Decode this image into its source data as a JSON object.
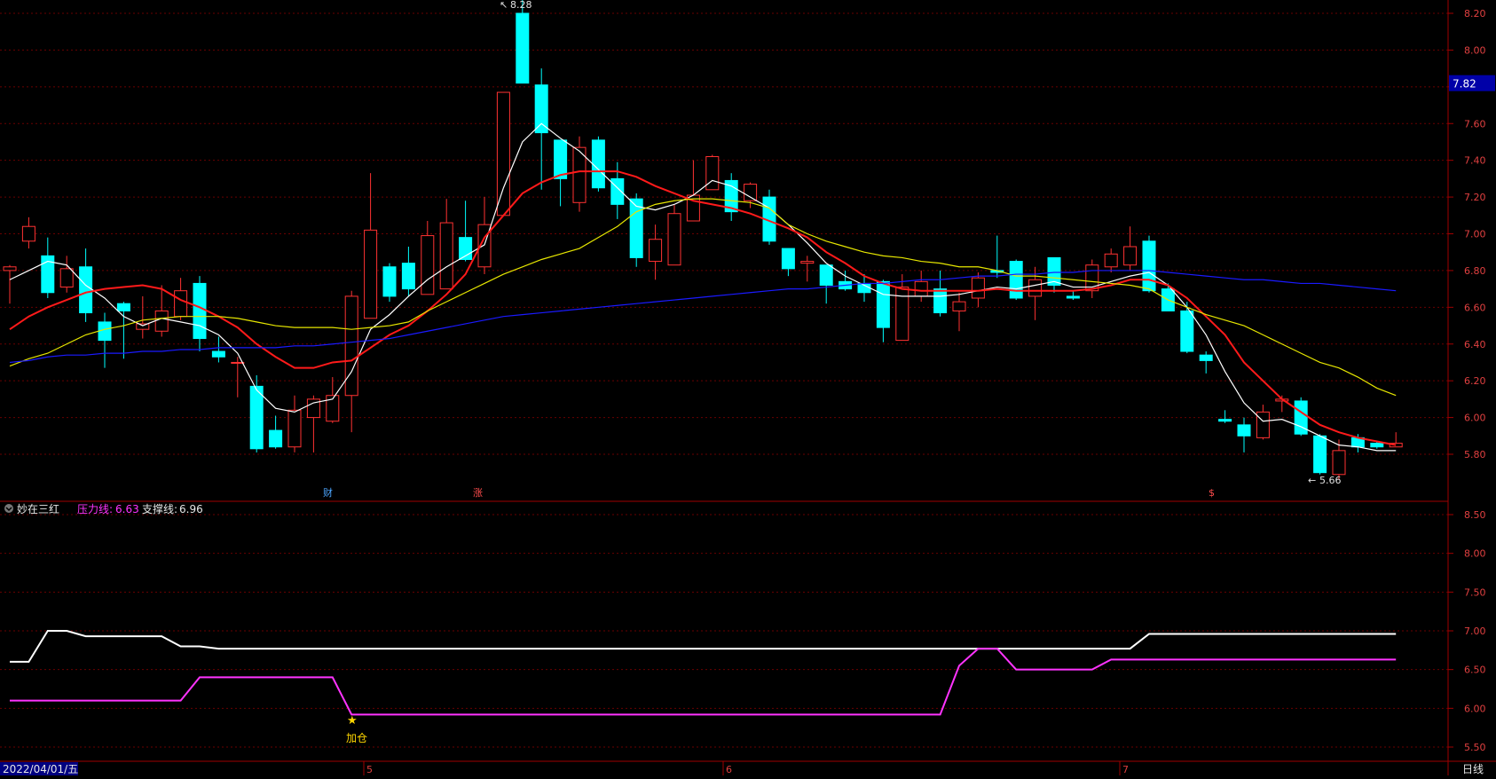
{
  "chart_data": {
    "type": "candlestick",
    "period_label": "日线",
    "date_label": "2022/04/01/五",
    "month_ticks": [
      "5",
      "6",
      "7"
    ],
    "main_panel": {
      "price_ticks": [
        "5.80",
        "6.00",
        "6.20",
        "6.40",
        "6.60",
        "6.80",
        "7.00",
        "7.20",
        "7.40",
        "7.60",
        "7.80",
        "8.00",
        "8.20"
      ],
      "ylim": [
        5.66,
        8.32
      ],
      "current_price": "7.82",
      "high_marker": "8.28",
      "low_marker": "5.66",
      "event_markers": [
        "财",
        "涨",
        "$"
      ],
      "candles": [
        [
          6.8,
          6.82,
          6.83,
          6.62
        ],
        [
          6.96,
          7.04,
          7.09,
          6.92
        ],
        [
          6.88,
          6.68,
          6.98,
          6.65
        ],
        [
          6.71,
          6.81,
          6.88,
          6.68
        ],
        [
          6.82,
          6.57,
          6.92,
          6.52
        ],
        [
          6.52,
          6.42,
          6.57,
          6.27
        ],
        [
          6.62,
          6.58,
          6.63,
          6.32
        ],
        [
          6.48,
          6.51,
          6.66,
          6.43
        ],
        [
          6.47,
          6.58,
          6.72,
          6.44
        ],
        [
          6.55,
          6.69,
          6.76,
          6.53
        ],
        [
          6.73,
          6.43,
          6.77,
          6.36
        ],
        [
          6.36,
          6.33,
          6.44,
          6.3
        ],
        [
          6.3,
          6.3,
          6.33,
          6.11
        ],
        [
          6.17,
          5.83,
          6.23,
          5.81
        ],
        [
          5.93,
          5.84,
          6.01,
          5.83
        ],
        [
          5.84,
          6.04,
          6.12,
          5.81
        ],
        [
          6.0,
          6.1,
          6.12,
          5.81
        ],
        [
          5.98,
          6.12,
          6.22,
          5.97
        ],
        [
          6.12,
          6.66,
          6.69,
          5.92
        ],
        [
          6.54,
          7.02,
          7.33,
          6.54
        ],
        [
          6.82,
          6.66,
          6.84,
          6.63
        ],
        [
          6.84,
          6.7,
          6.93,
          6.66
        ],
        [
          6.67,
          6.99,
          7.07,
          6.67
        ],
        [
          6.7,
          7.06,
          7.19,
          6.7
        ],
        [
          6.98,
          6.86,
          7.18,
          6.85
        ],
        [
          6.82,
          7.05,
          7.2,
          6.78
        ],
        [
          7.1,
          7.77,
          7.77,
          7.1
        ],
        [
          8.2,
          7.82,
          8.28,
          7.82
        ],
        [
          7.81,
          7.55,
          7.9,
          7.24
        ],
        [
          7.51,
          7.3,
          7.51,
          7.15
        ],
        [
          7.17,
          7.47,
          7.53,
          7.12
        ],
        [
          7.51,
          7.25,
          7.53,
          7.23
        ],
        [
          7.3,
          7.16,
          7.39,
          7.08
        ],
        [
          7.19,
          6.87,
          7.22,
          6.82
        ],
        [
          6.85,
          6.97,
          7.05,
          6.75
        ],
        [
          6.83,
          7.11,
          7.16,
          6.83
        ],
        [
          7.07,
          7.21,
          7.4,
          7.07
        ],
        [
          7.24,
          7.42,
          7.43,
          7.24
        ],
        [
          7.29,
          7.12,
          7.33,
          7.07
        ],
        [
          7.18,
          7.27,
          7.28,
          7.14
        ],
        [
          7.2,
          6.96,
          7.24,
          6.94
        ],
        [
          6.92,
          6.81,
          6.92,
          6.77
        ],
        [
          6.84,
          6.85,
          6.88,
          6.74
        ],
        [
          6.83,
          6.72,
          6.83,
          6.62
        ],
        [
          6.74,
          6.7,
          6.8,
          6.69
        ],
        [
          6.73,
          6.68,
          6.78,
          6.63
        ],
        [
          6.74,
          6.49,
          6.75,
          6.41
        ],
        [
          6.42,
          6.71,
          6.78,
          6.42
        ],
        [
          6.66,
          6.74,
          6.8,
          6.63
        ],
        [
          6.7,
          6.57,
          6.8,
          6.55
        ],
        [
          6.58,
          6.63,
          6.68,
          6.47
        ],
        [
          6.65,
          6.76,
          6.79,
          6.6
        ],
        [
          6.8,
          6.79,
          6.99,
          6.76
        ],
        [
          6.85,
          6.65,
          6.86,
          6.64
        ],
        [
          6.66,
          6.75,
          6.82,
          6.53
        ],
        [
          6.87,
          6.72,
          6.87,
          6.68
        ],
        [
          6.66,
          6.65,
          6.69,
          6.64
        ],
        [
          6.69,
          6.83,
          6.86,
          6.65
        ],
        [
          6.82,
          6.89,
          6.92,
          6.79
        ],
        [
          6.83,
          6.93,
          7.04,
          6.8
        ],
        [
          6.96,
          6.69,
          6.99,
          6.68
        ],
        [
          6.7,
          6.58,
          6.73,
          6.58
        ],
        [
          6.58,
          6.36,
          6.63,
          6.35
        ],
        [
          6.34,
          6.31,
          6.36,
          6.24
        ],
        [
          5.99,
          5.98,
          6.04,
          5.97
        ],
        [
          5.96,
          5.9,
          6.0,
          5.81
        ],
        [
          5.89,
          6.03,
          6.07,
          5.88
        ],
        [
          6.09,
          6.1,
          6.12,
          6.03
        ],
        [
          6.09,
          5.91,
          6.11,
          5.9
        ],
        [
          5.9,
          5.7,
          5.91,
          5.69
        ],
        [
          5.69,
          5.82,
          5.88,
          5.66
        ],
        [
          5.89,
          5.84,
          5.91,
          5.81
        ],
        [
          5.86,
          5.84,
          5.87,
          5.83
        ],
        [
          5.84,
          5.86,
          5.92,
          5.84
        ]
      ],
      "series": [
        {
          "name": "MA5",
          "color": "#ffffff",
          "values": [
            6.75,
            6.8,
            6.85,
            6.83,
            6.72,
            6.65,
            6.55,
            6.5,
            6.54,
            6.52,
            6.5,
            6.45,
            6.35,
            6.15,
            6.05,
            6.03,
            6.08,
            6.1,
            6.25,
            6.48,
            6.56,
            6.66,
            6.75,
            6.82,
            6.88,
            6.94,
            7.25,
            7.5,
            7.6,
            7.52,
            7.45,
            7.35,
            7.25,
            7.15,
            7.13,
            7.16,
            7.21,
            7.29,
            7.26,
            7.2,
            7.14,
            7.05,
            6.95,
            6.84,
            6.77,
            6.72,
            6.67,
            6.66,
            6.66,
            6.66,
            6.67,
            6.69,
            6.71,
            6.7,
            6.72,
            6.74,
            6.71,
            6.71,
            6.74,
            6.77,
            6.79,
            6.72,
            6.6,
            6.45,
            6.25,
            6.08,
            5.98,
            5.99,
            5.95,
            5.9,
            5.85,
            5.84,
            5.82,
            5.82
          ]
        },
        {
          "name": "MA10",
          "color": "#ff1a1a",
          "values": [
            6.48,
            6.55,
            6.6,
            6.64,
            6.68,
            6.7,
            6.71,
            6.72,
            6.7,
            6.64,
            6.6,
            6.55,
            6.49,
            6.4,
            6.33,
            6.27,
            6.27,
            6.3,
            6.31,
            6.38,
            6.45,
            6.5,
            6.58,
            6.67,
            6.78,
            6.98,
            7.1,
            7.22,
            7.28,
            7.32,
            7.34,
            7.34,
            7.34,
            7.31,
            7.26,
            7.22,
            7.18,
            7.16,
            7.14,
            7.11,
            7.07,
            7.03,
            6.98,
            6.9,
            6.84,
            6.77,
            6.73,
            6.7,
            6.69,
            6.69,
            6.69,
            6.69,
            6.7,
            6.69,
            6.69,
            6.69,
            6.69,
            6.7,
            6.72,
            6.75,
            6.75,
            6.72,
            6.65,
            6.55,
            6.45,
            6.3,
            6.2,
            6.1,
            6.03,
            5.96,
            5.92,
            5.89,
            5.87,
            5.85
          ]
        },
        {
          "name": "MA20",
          "color": "#e6e600",
          "values": [
            6.28,
            6.32,
            6.35,
            6.4,
            6.45,
            6.48,
            6.5,
            6.53,
            6.54,
            6.55,
            6.55,
            6.55,
            6.54,
            6.52,
            6.5,
            6.49,
            6.49,
            6.49,
            6.48,
            6.49,
            6.5,
            6.52,
            6.58,
            6.63,
            6.68,
            6.73,
            6.78,
            6.82,
            6.86,
            6.89,
            6.92,
            6.98,
            7.04,
            7.12,
            7.16,
            7.18,
            7.19,
            7.19,
            7.18,
            7.17,
            7.14,
            7.05,
            7.0,
            6.96,
            6.93,
            6.9,
            6.88,
            6.87,
            6.85,
            6.84,
            6.82,
            6.82,
            6.8,
            6.77,
            6.77,
            6.76,
            6.75,
            6.74,
            6.73,
            6.72,
            6.7,
            6.64,
            6.6,
            6.56,
            6.53,
            6.5,
            6.45,
            6.4,
            6.35,
            6.3,
            6.27,
            6.22,
            6.16,
            6.12
          ]
        },
        {
          "name": "MA60",
          "color": "#1a1aff",
          "values": [
            6.3,
            6.31,
            6.33,
            6.34,
            6.34,
            6.35,
            6.35,
            6.36,
            6.36,
            6.37,
            6.37,
            6.38,
            6.38,
            6.38,
            6.38,
            6.39,
            6.39,
            6.4,
            6.41,
            6.42,
            6.43,
            6.45,
            6.47,
            6.49,
            6.51,
            6.53,
            6.55,
            6.56,
            6.57,
            6.58,
            6.59,
            6.6,
            6.61,
            6.62,
            6.63,
            6.64,
            6.65,
            6.66,
            6.67,
            6.68,
            6.69,
            6.7,
            6.7,
            6.71,
            6.72,
            6.73,
            6.73,
            6.74,
            6.75,
            6.75,
            6.76,
            6.77,
            6.77,
            6.78,
            6.78,
            6.79,
            6.79,
            6.8,
            6.8,
            6.8,
            6.8,
            6.79,
            6.78,
            6.77,
            6.76,
            6.75,
            6.75,
            6.74,
            6.73,
            6.73,
            6.72,
            6.71,
            6.7,
            6.69
          ]
        }
      ]
    },
    "sub_panel": {
      "indicator_name": "妙在三红",
      "pressure_label": "压力线:",
      "pressure_value": "6.63",
      "support_label": "支撑线:",
      "support_value": "6.96",
      "price_ticks": [
        "5.50",
        "6.00",
        "6.50",
        "7.00",
        "7.50",
        "8.00",
        "8.50"
      ],
      "ylim": [
        5.4,
        8.65
      ],
      "signal_label": "加仓",
      "signal_index": 18,
      "series": [
        {
          "name": "支撑线",
          "color": "#ffffff",
          "values": [
            6.6,
            6.6,
            7.0,
            7.0,
            6.93,
            6.93,
            6.93,
            6.93,
            6.93,
            6.8,
            6.8,
            6.77,
            6.77,
            6.77,
            6.77,
            6.77,
            6.77,
            6.77,
            6.77,
            6.77,
            6.77,
            6.77,
            6.77,
            6.77,
            6.77,
            6.77,
            6.77,
            6.77,
            6.77,
            6.77,
            6.77,
            6.77,
            6.77,
            6.77,
            6.77,
            6.77,
            6.77,
            6.77,
            6.77,
            6.77,
            6.77,
            6.77,
            6.77,
            6.77,
            6.77,
            6.77,
            6.77,
            6.77,
            6.77,
            6.77,
            6.77,
            6.77,
            6.77,
            6.77,
            6.77,
            6.77,
            6.77,
            6.77,
            6.77,
            6.77,
            6.96,
            6.96,
            6.96,
            6.96,
            6.96,
            6.96,
            6.96,
            6.96,
            6.96,
            6.96,
            6.96,
            6.96,
            6.96,
            6.96
          ]
        },
        {
          "name": "压力线",
          "color": "#ff33ff",
          "values": [
            6.1,
            6.1,
            6.1,
            6.1,
            6.1,
            6.1,
            6.1,
            6.1,
            6.1,
            6.1,
            6.4,
            6.4,
            6.4,
            6.4,
            6.4,
            6.4,
            6.4,
            6.4,
            5.92,
            5.92,
            5.92,
            5.92,
            5.92,
            5.92,
            5.92,
            5.92,
            5.92,
            5.92,
            5.92,
            5.92,
            5.92,
            5.92,
            5.92,
            5.92,
            5.92,
            5.92,
            5.92,
            5.92,
            5.92,
            5.92,
            5.92,
            5.92,
            5.92,
            5.92,
            5.92,
            5.92,
            5.92,
            5.92,
            5.92,
            5.92,
            6.55,
            6.77,
            6.77,
            6.5,
            6.5,
            6.5,
            6.5,
            6.5,
            6.63,
            6.63,
            6.63,
            6.63,
            6.63,
            6.63,
            6.63,
            6.63,
            6.63,
            6.63,
            6.63,
            6.63,
            6.63,
            6.63,
            6.63,
            6.63
          ]
        }
      ]
    }
  }
}
